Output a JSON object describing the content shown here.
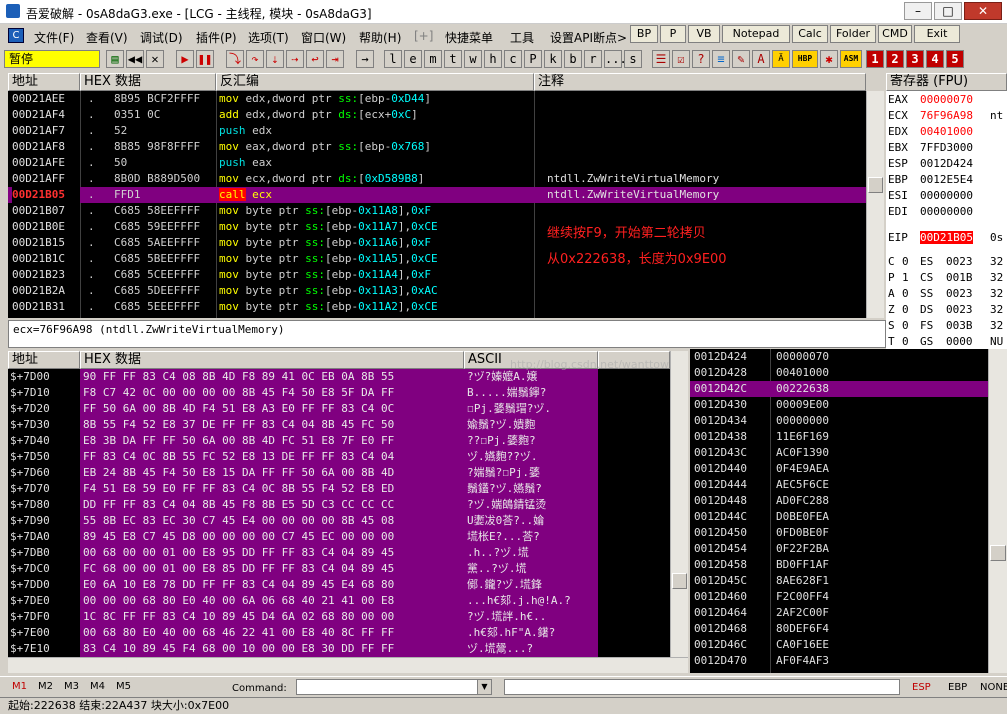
{
  "title": "吾爱破解 - 0sA8daG3.exe - [LCG - 主线程, 模块 - 0sA8daG3]",
  "window_buttons": [
    "–",
    "□",
    "✕"
  ],
  "menu": [
    "文件(F)",
    "查看(V)",
    "调试(D)",
    "插件(P)",
    "选项(T)",
    "窗口(W)",
    "帮助(H)",
    "[+]",
    "快捷菜单",
    "工具",
    "设置API断点>"
  ],
  "top_buttons": [
    "BP",
    "P",
    "VB",
    "Notepad",
    "Calc",
    "Folder",
    "CMD",
    "Exit"
  ],
  "status_pause": "暂停",
  "toolbar_letters": [
    "l",
    "e",
    "m",
    "t",
    "w",
    "h",
    "c",
    "P",
    "k",
    "b",
    "r",
    "...",
    "s"
  ],
  "toolbar_nums": [
    "1",
    "2",
    "3",
    "4",
    "5"
  ],
  "cpu_headers": {
    "addr": "地址",
    "hex": "HEX 数据",
    "disasm": "反汇编",
    "comment": "注释"
  },
  "cpu_rows": [
    {
      "addr": "00D21AEE",
      "mark": ".",
      "hex": "8B95 BCF2FFFF",
      "dis": "mov edx,dword ptr ss:[ebp-0xD44]",
      "cm": ""
    },
    {
      "addr": "00D21AF4",
      "mark": ".",
      "hex": "0351 0C",
      "dis": "add edx,dword ptr ds:[ecx+0xC]",
      "cm": ""
    },
    {
      "addr": "00D21AF7",
      "mark": ".",
      "hex": "52",
      "dis": "push edx",
      "cm": ""
    },
    {
      "addr": "00D21AF8",
      "mark": ".",
      "hex": "8B85 98F8FFFF",
      "dis": "mov eax,dword ptr ss:[ebp-0x768]",
      "cm": ""
    },
    {
      "addr": "00D21AFE",
      "mark": ".",
      "hex": "50",
      "dis": "push eax",
      "cm": ""
    },
    {
      "addr": "00D21AFF",
      "mark": ".",
      "hex": "8B0D B889D500",
      "dis": "mov ecx,dword ptr ds:[0xD589B8]",
      "cm": "ntdll.ZwWriteVirtualMemory"
    },
    {
      "addr": "00D21B05",
      "mark": ".",
      "hex": "FFD1",
      "dis": "call ecx",
      "cm": "ntdll.ZwWriteVirtualMemory"
    },
    {
      "addr": "00D21B07",
      "mark": ".",
      "hex": "C685 58EEFFFF",
      "dis": "mov byte ptr ss:[ebp-0x11A8],0xF",
      "cm": ""
    },
    {
      "addr": "00D21B0E",
      "mark": ".",
      "hex": "C685 59EEFFFF",
      "dis": "mov byte ptr ss:[ebp-0x11A7],0xCE",
      "cm": ""
    },
    {
      "addr": "00D21B15",
      "mark": ".",
      "hex": "C685 5AEEFFFF",
      "dis": "mov byte ptr ss:[ebp-0x11A6],0xF",
      "cm": ""
    },
    {
      "addr": "00D21B1C",
      "mark": ".",
      "hex": "C685 5BEEFFFF",
      "dis": "mov byte ptr ss:[ebp-0x11A5],0xCE",
      "cm": ""
    },
    {
      "addr": "00D21B23",
      "mark": ".",
      "hex": "C685 5CEEFFFF",
      "dis": "mov byte ptr ss:[ebp-0x11A4],0xF",
      "cm": ""
    },
    {
      "addr": "00D21B2A",
      "mark": ".",
      "hex": "C685 5DEEFFFF",
      "dis": "mov byte ptr ss:[ebp-0x11A3],0xAC",
      "cm": ""
    },
    {
      "addr": "00D21B31",
      "mark": ".",
      "hex": "C685 5EEEFFFF",
      "dis": "mov byte ptr ss:[ebp-0x11A2],0xCE",
      "cm": ""
    }
  ],
  "annotation": [
    "继续按F9，开始第二轮拷贝",
    "从0x222638，长度为0x9E00"
  ],
  "info_line": "ecx=76F96A98 (ntdll.ZwWriteVirtualMemory)",
  "reg_header": "寄存器 (FPU)",
  "registers": [
    {
      "n": "EAX",
      "v": "00000070",
      "x": ""
    },
    {
      "n": "ECX",
      "v": "76F96A98",
      "x": "nt"
    },
    {
      "n": "EDX",
      "v": "00401000",
      "x": ""
    },
    {
      "n": "EBX",
      "v": "7FFD3000",
      "x": ""
    },
    {
      "n": "ESP",
      "v": "0012D424",
      "x": ""
    },
    {
      "n": "EBP",
      "v": "0012E5E4",
      "x": ""
    },
    {
      "n": "ESI",
      "v": "00000000",
      "x": ""
    },
    {
      "n": "EDI",
      "v": "00000000",
      "x": ""
    }
  ],
  "eip": {
    "n": "EIP",
    "v": "00D21B05",
    "x": "0s"
  },
  "flags": [
    {
      "f": "C",
      "b": "0",
      "s": "ES",
      "sv": "0023",
      "e": "32"
    },
    {
      "f": "P",
      "b": "1",
      "s": "CS",
      "sv": "001B",
      "e": "32"
    },
    {
      "f": "A",
      "b": "0",
      "s": "SS",
      "sv": "0023",
      "e": "32"
    },
    {
      "f": "Z",
      "b": "0",
      "s": "DS",
      "sv": "0023",
      "e": "32"
    },
    {
      "f": "S",
      "b": "0",
      "s": "FS",
      "sv": "003B",
      "e": "32"
    },
    {
      "f": "T",
      "b": "0",
      "s": "GS",
      "sv": "0000",
      "e": "NU"
    }
  ],
  "dump_headers": {
    "addr": "地址",
    "hex": "HEX 数据",
    "ascii": "ASCII"
  },
  "dump_rows": [
    {
      "a": "$+7D00",
      "h": "90 FF FF 83 C4 08 8B 4D F8 89 41 0C EB 0A 8B 55",
      "s": "?ヅ?嫀嬤A.嬢"
    },
    {
      "a": "$+7D10",
      "h": "F8 C7 42 0C 00 00 00 00 8B 45 F4 50 E8 5F DA FF",
      "s": " B.....媏鬚鑏?"
    },
    {
      "a": "$+7D20",
      "h": "FF 50 6A 00 8B 4D F4 51 E8 A3 E0 FF FF 83 C4 0C",
      "s": "﾿Pj.婱鬚瑁?ヅ."
    },
    {
      "a": "$+7D30",
      "h": "8B 55 F4 52 E8 37 DE FF FF 83 C4 04 8B 45 FC 50",
      "s": "婾鬚?ヅ.嬇麭"
    },
    {
      "a": "$+7D40",
      "h": "E8 3B DA FF FF 50 6A 00 8B 4D FC 51 E8 7F E0 FF",
      "s": "??﾿Pj.婱麭?"
    },
    {
      "a": "$+7D50",
      "h": "FF 83 C4 0C 8B 55 FC 52 E8 13 DE FF FF 83 C4 04",
      "s": "ヅ.嬿麭??ヅ."
    },
    {
      "a": "$+7D60",
      "h": "EB 24 8B 45 F4 50 E8 15 DA FF FF 50 6A 00 8B 4D",
      "s": "?媏鬚?﾿Pj.婱"
    },
    {
      "a": "$+7D70",
      "h": "F4 51 E8 59 E0 FF FF 83 C4 0C 8B 55 F4 52 E8 ED",
      "s": "鬚鑉?ヅ.嬿鬚?"
    },
    {
      "a": "$+7D80",
      "h": "DD FF FF 83 C4 04 8B 45 F8 8B E5 5D C3 CC CC CC",
      "s": "?ヅ.媏鴭錆锰烫"
    },
    {
      "a": "$+7D90",
      "h": "55 8B EC 83 EC 30 C7 45 E4 00 00 00 00 8B 45 08",
      "s": "U嬱冹0荅?..婨"
    },
    {
      "a": "$+7DA0",
      "h": "89 45 E8 C7 45 D8 00 00 00 00 C7 45 EC 00 00 00",
      "s": "塃枨E?...荅?"
    },
    {
      "a": "$+7DB0",
      "h": "00 68 00 00 01 00 E8 95 DD FF FF 83 C4 04 89 45",
      "s": ".h..?ヅ.塃"
    },
    {
      "a": "$+7DC0",
      "h": "FC 68 00 00 01 00 E8 85 DD FF FF 83 C4 04 89 45",
      "s": "黨..?ヅ.塃"
    },
    {
      "a": "$+7DD0",
      "h": "E0 6A 10 E8 78 DD FF FF 83 C4 04 89 45 E4 68 80",
      "s": "鄇.鑨?ヅ.塃鋒"
    },
    {
      "a": "$+7DE0",
      "h": "00 00 00 68 80 E0 40 00 6A 06 68 40 21 41 00 E8",
      "s": "...h€郂.j.h@!A.?"
    },
    {
      "a": "$+7DF0",
      "h": "1C 8C FF FF 83 C4 10 89 45 D4 6A 02 68 80 00 00",
      "s": "?ヅ.塃詊.h€.."
    },
    {
      "a": "$+7E00",
      "h": "00 68 80 E0 40 00 68 46 22 41 00 E8 40 8C FF FF",
      "s": ".h€郂.hF\"A.鐯?"
    },
    {
      "a": "$+7E10",
      "h": "83 C4 10 89 45 F4 68 00 10 00 00 E8 30 DD FF FF",
      "s": "ヅ.塃鬶...?"
    }
  ],
  "stack_rows": [
    {
      "a": "0012D424",
      "v": "00000070"
    },
    {
      "a": "0012D428",
      "v": "00401000"
    },
    {
      "a": "0012D42C",
      "v": "00222638"
    },
    {
      "a": "0012D430",
      "v": "00009E00"
    },
    {
      "a": "0012D434",
      "v": "00000000"
    },
    {
      "a": "0012D438",
      "v": "11E6F169"
    },
    {
      "a": "0012D43C",
      "v": "AC0F1390"
    },
    {
      "a": "0012D440",
      "v": "0F4E9AEA"
    },
    {
      "a": "0012D444",
      "v": "AEC5F6CE"
    },
    {
      "a": "0012D448",
      "v": "AD0FC288"
    },
    {
      "a": "0012D44C",
      "v": "D0BE0FEA"
    },
    {
      "a": "0012D450",
      "v": "0FD0BE0F"
    },
    {
      "a": "0012D454",
      "v": "0F22F2BA"
    },
    {
      "a": "0012D458",
      "v": "BD0FF1AF"
    },
    {
      "a": "0012D45C",
      "v": "8AE628F1"
    },
    {
      "a": "0012D460",
      "v": "F2C00FF4"
    },
    {
      "a": "0012D464",
      "v": "2AF2C00F"
    },
    {
      "a": "0012D468",
      "v": "80DEF6F4"
    },
    {
      "a": "0012D46C",
      "v": "CA0F16EE"
    },
    {
      "a": "0012D470",
      "v": "AF0F4AF3"
    }
  ],
  "watermark": "http://blog.csdn.net/wanttowin",
  "bottom_tabs": [
    "M1",
    "M2",
    "M3",
    "M4",
    "M5"
  ],
  "command_label": "Command:",
  "bottom_right": [
    "ESP",
    "EBP",
    "NONE"
  ],
  "status_line": "起始:222638 结束:22A437 块大小:0x7E00",
  "colors": {
    "purple": "#800080",
    "highlight": "#800080",
    "red": "#ff0000",
    "yellow": "#ffff00",
    "green": "#00ff00",
    "cyan": "#00ffff",
    "blue": "#0000ff"
  }
}
